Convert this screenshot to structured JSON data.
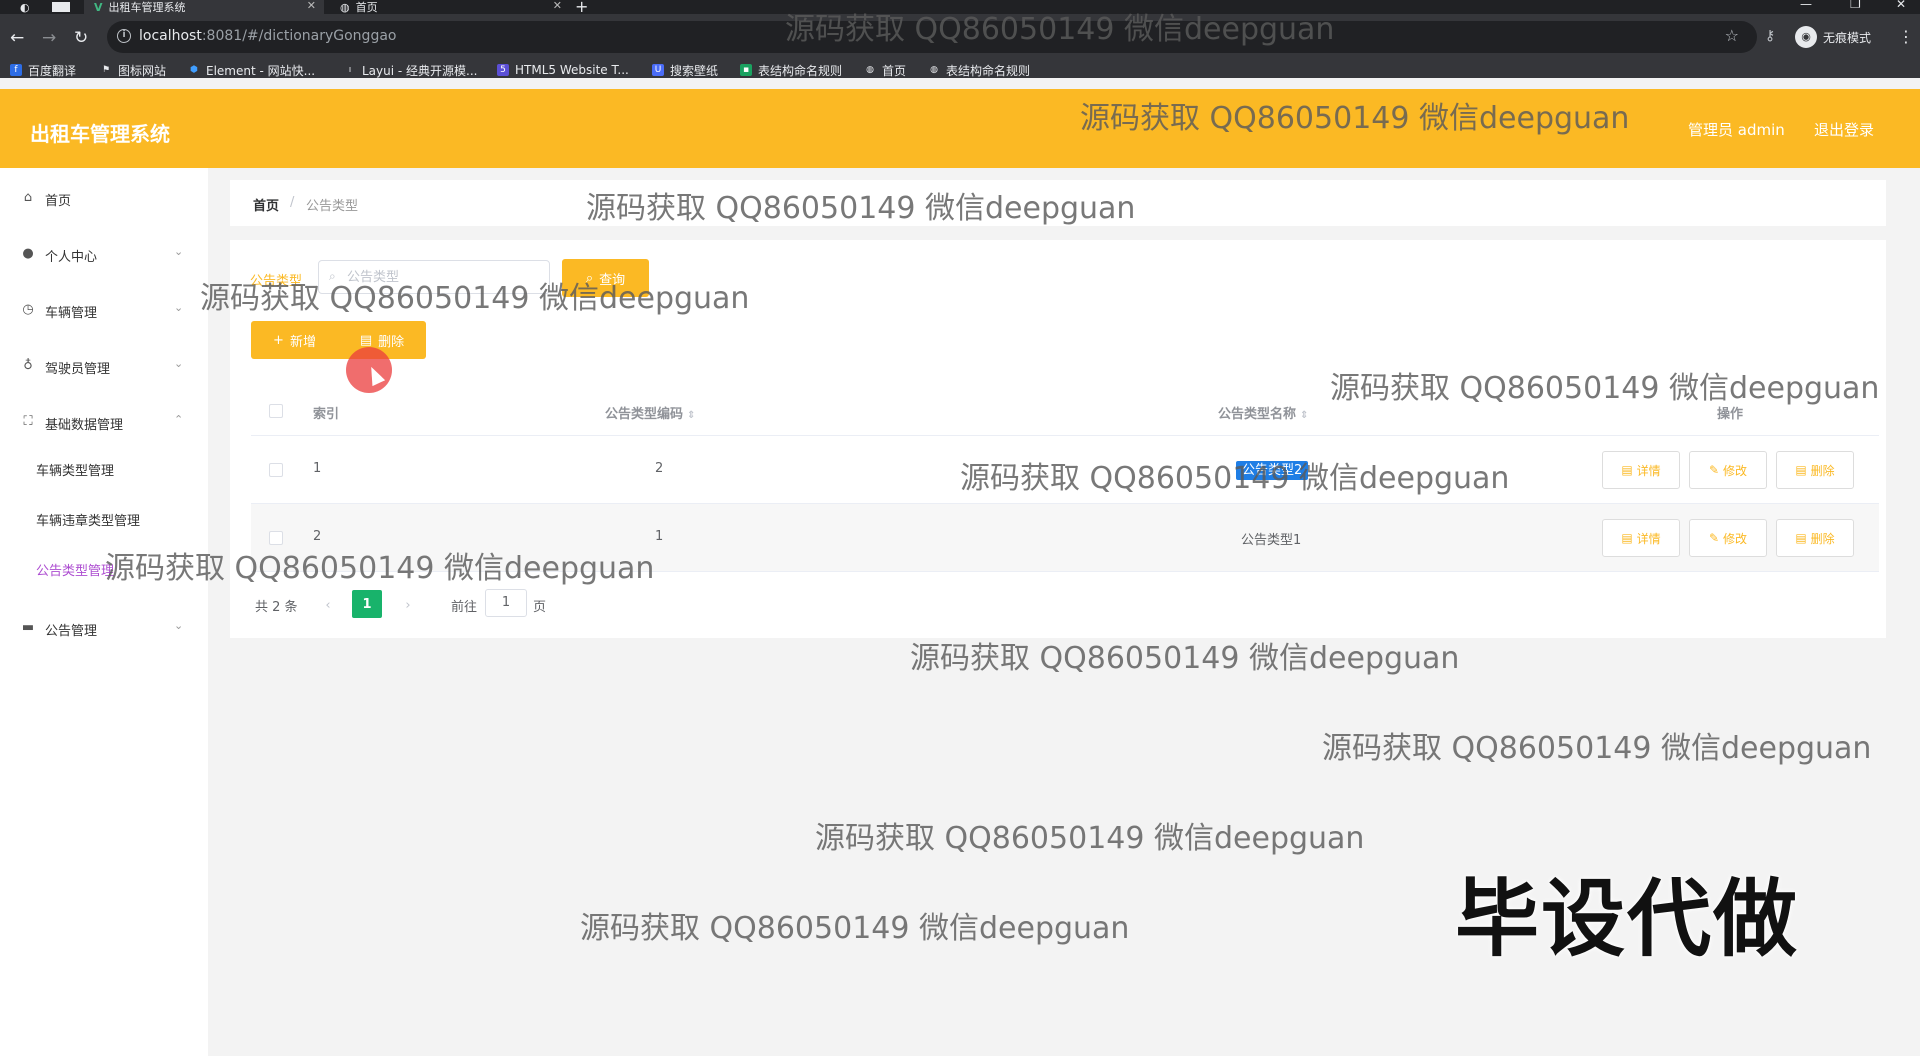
{
  "browser": {
    "tabs": [
      {
        "label": "出租车管理系统",
        "active": true
      },
      {
        "label": "首页",
        "active": false
      }
    ],
    "url_host": "localhost",
    "url_rest": ":8081/#/dictionaryGonggao",
    "profile_label": "无痕模式",
    "bookmarks": [
      "百度翻译",
      "图标网站",
      "Element - 网站快...",
      "Layui - 经典开源模...",
      "HTML5 Website T...",
      "搜索壁纸",
      "表结构命名规则",
      "首页",
      "表结构命名规则"
    ]
  },
  "header": {
    "title": "出租车管理系统",
    "user": "管理员 admin",
    "logout": "退出登录",
    "bg_color": "#fbb924"
  },
  "sidebar": {
    "items": [
      {
        "label": "首页",
        "icon": "home-icon"
      },
      {
        "label": "个人中心",
        "icon": "user-icon"
      },
      {
        "label": "车辆管理",
        "icon": "clock-icon"
      },
      {
        "label": "驾驶员管理",
        "icon": "microphone-icon"
      },
      {
        "label": "基础数据管理",
        "icon": "fullscreen-icon"
      },
      {
        "label": "公告管理",
        "icon": "suitcase-icon"
      }
    ],
    "subitems": [
      {
        "label": "车辆类型管理",
        "active": false
      },
      {
        "label": "车辆违章类型管理",
        "active": false
      },
      {
        "label": "公告类型管理",
        "active": true
      }
    ]
  },
  "breadcrumb": {
    "home": "首页",
    "separator": "/",
    "current": "公告类型"
  },
  "search": {
    "label": "公告类型",
    "placeholder": "公告类型",
    "query_button": "查询"
  },
  "actions": {
    "add": "新增",
    "delete": "删除"
  },
  "table": {
    "columns": [
      "索引",
      "公告类型编码",
      "公告类型名称",
      "操作"
    ],
    "rows": [
      {
        "index": "1",
        "code": "2",
        "name": "公告类型2"
      },
      {
        "index": "2",
        "code": "1",
        "name": "公告类型1"
      }
    ],
    "row_actions": [
      "详情",
      "修改",
      "删除"
    ]
  },
  "pagination": {
    "total": "共 2 条",
    "current_page": "1",
    "goto_label": "前往",
    "goto_value": "1",
    "page_suffix": "页"
  },
  "overlay": {
    "watermark": "源码获取 QQ86050149 微信deepguan",
    "banner": "毕设代做"
  }
}
